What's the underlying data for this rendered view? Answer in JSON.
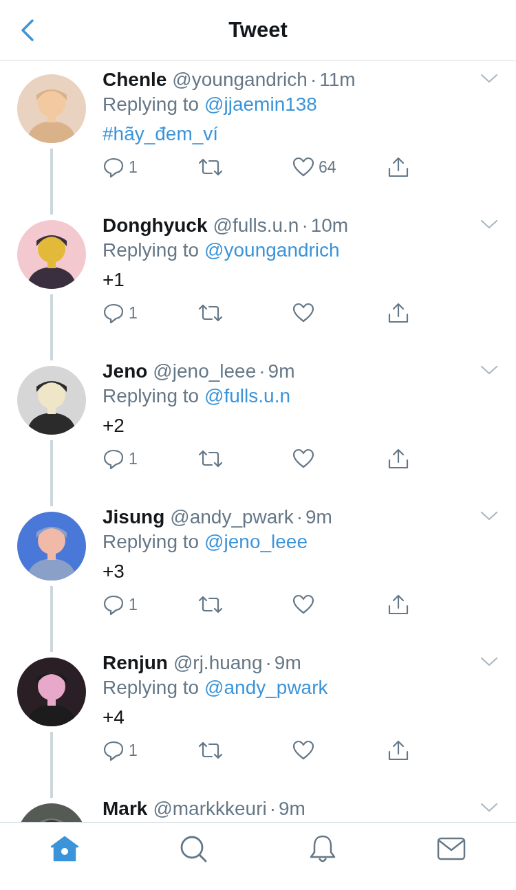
{
  "header": {
    "title": "Tweet"
  },
  "tweets": [
    {
      "name": "Chenle",
      "handle": "@youngandrich",
      "separator": "·",
      "time": "11m",
      "reply_prefix": "Replying to",
      "reply_to": "@jjaemin138",
      "body": {
        "kind": "hashtag",
        "text": "#hãy_đem_ví"
      },
      "replies": "1",
      "likes": "64"
    },
    {
      "name": "Donghyuck",
      "handle": "@fulls.u.n",
      "separator": "·",
      "time": "10m",
      "reply_prefix": "Replying to",
      "reply_to": "@youngandrich",
      "body": {
        "kind": "plain",
        "text": "+1"
      },
      "replies": "1"
    },
    {
      "name": "Jeno",
      "handle": "@jeno_leee",
      "separator": "·",
      "time": "9m",
      "reply_prefix": "Replying to",
      "reply_to": "@fulls.u.n",
      "body": {
        "kind": "plain",
        "text": "+2"
      },
      "replies": "1"
    },
    {
      "name": "Jisung",
      "handle": "@andy_pwark",
      "separator": "·",
      "time": "9m",
      "reply_prefix": "Replying to",
      "reply_to": "@jeno_leee",
      "body": {
        "kind": "plain",
        "text": "+3"
      },
      "replies": "1"
    },
    {
      "name": "Renjun",
      "handle": "@rj.huang",
      "separator": "·",
      "time": "9m",
      "reply_prefix": "Replying to",
      "reply_to": "@andy_pwark",
      "body": {
        "kind": "plain",
        "text": "+4"
      },
      "replies": "1"
    },
    {
      "name": "Mark",
      "handle": "@markkkeuri",
      "separator": "·",
      "time": "9m"
    }
  ],
  "tab_bar": [
    {
      "kind": "home",
      "selected": true
    },
    {
      "kind": "search",
      "selected": false
    },
    {
      "kind": "notifications",
      "selected": false
    },
    {
      "kind": "messages",
      "selected": false
    }
  ]
}
